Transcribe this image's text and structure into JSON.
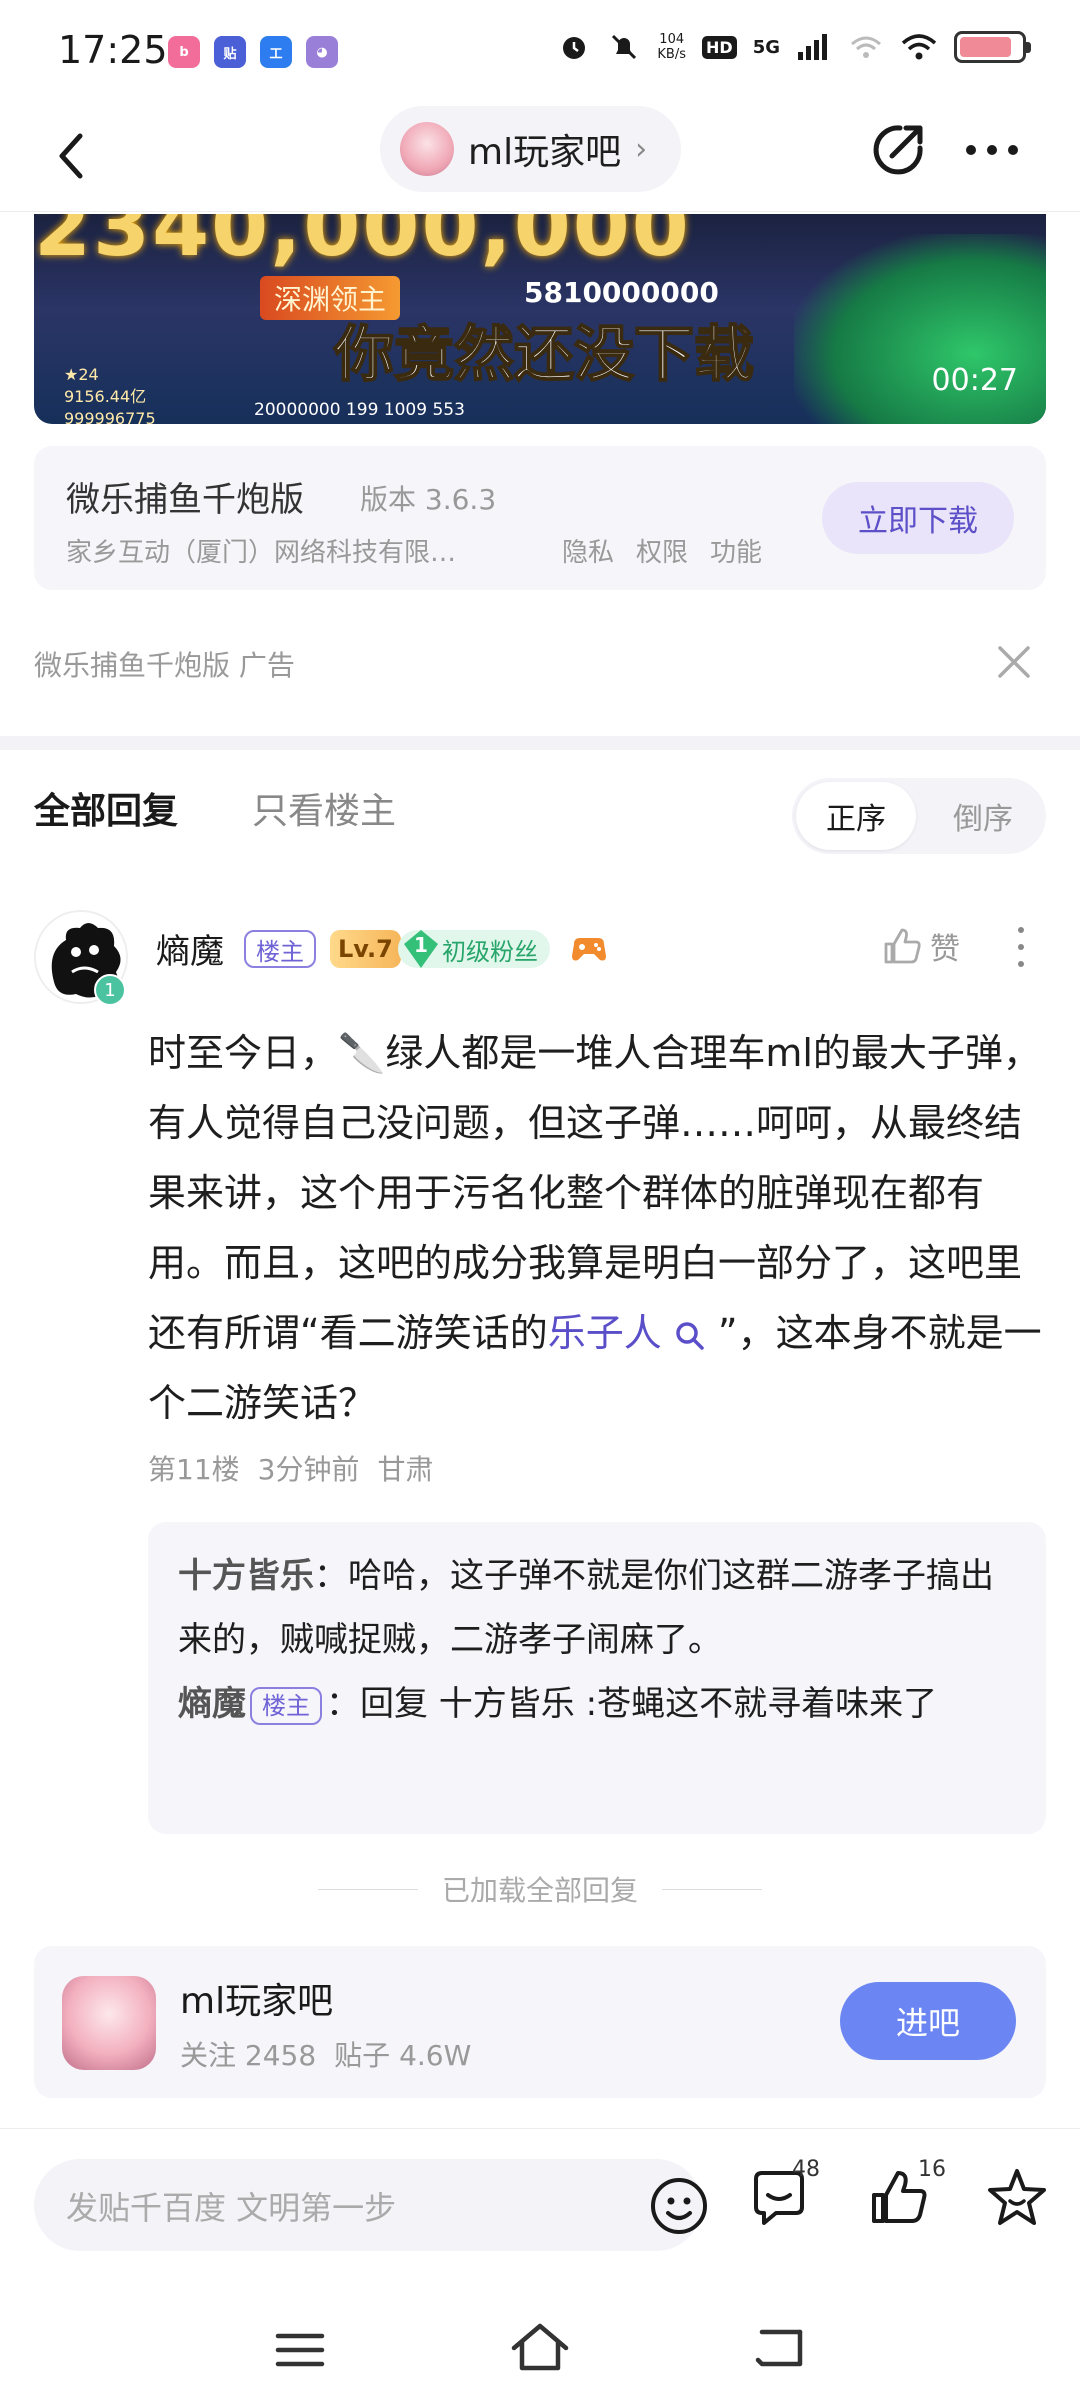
{
  "status_bar": {
    "time": "17:25",
    "app_icons": [
      "bili",
      "贴",
      "工",
      "av"
    ],
    "net_speed_value": "104",
    "net_speed_unit": "KB/s",
    "hd": "HD",
    "network": "5G",
    "battery_level": 0.85
  },
  "header": {
    "forum_name": "ml玩家吧",
    "chevron": "›"
  },
  "ad": {
    "video": {
      "big_number": "2340,000,000",
      "tag": "深渊领主",
      "number2": "5810000000",
      "headline": "你竟然还没下载",
      "duration": "00:27",
      "stats_line1": "★24",
      "stats_line2": "9156.44亿",
      "stats_line3": "999996775",
      "bottom_stats": "20000000  199  1009  553"
    },
    "app_name": "微乐捕鱼千炮版",
    "version": "版本 3.6.3",
    "company": "家乡互动（厦门）网络科技有限…",
    "links": [
      "隐私",
      "权限",
      "功能"
    ],
    "download_label": "立即下载",
    "footer_text": "微乐捕鱼千炮版  广告"
  },
  "replies": {
    "tab_all": "全部回复",
    "tab_op_only": "只看楼主",
    "sort_asc": "正序",
    "sort_desc": "倒序"
  },
  "post": {
    "author": "熵魔",
    "badge_op": "楼主",
    "badge_level": "Lv.7",
    "fan_level": "1",
    "fan_label": "初级粉丝",
    "like_label": "赞",
    "body_part1": "时至今日，🔪绿人都是一堆人合理车ml的最大子弹，有人觉得自己没问题，但这子弹……呵呵，从最终结果来讲，这个用于污名化整个群体的脏弹现在都有用。而且，这吧的成分我算是明白一部分了，这吧里还有所谓“看二游笑话的",
    "topic_link": "乐子人",
    "body_part2": "”，这本身不就是一个二游笑话？",
    "floor": "第11楼",
    "time": "3分钟前",
    "location": "甘肃",
    "avatar_badge": "1",
    "subreplies": [
      {
        "name": "十方皆乐",
        "separator": "：",
        "text": "哈哈，这子弹不就是你们这群二游孝子搞出来的，贼喊捉贼，二游孝子闹麻了。"
      },
      {
        "name": "熵魔",
        "badge": "楼主",
        "separator": "：",
        "text": "回复 十方皆乐 :苍蝇这不就寻着味来了"
      }
    ]
  },
  "loaded_all": "已加载全部回复",
  "forum_card": {
    "name": "ml玩家吧",
    "followers": "关注 2458",
    "posts": "贴子 4.6W",
    "join_label": "进吧"
  },
  "bottom_bar": {
    "input_placeholder": "发贴千百度 文明第一步",
    "comment_count": "48",
    "like_count": "16"
  },
  "colors": {
    "accent": "#6b86f2",
    "topic": "#5a4fc9",
    "badge_purple": "#8b80e0",
    "fan_green": "#27a56a"
  }
}
